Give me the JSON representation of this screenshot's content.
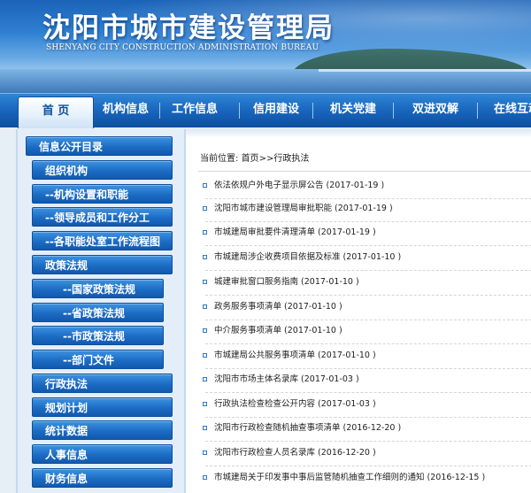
{
  "header": {
    "title": "沈阳市城市建设管理局",
    "subtitle": "SHENYANG CITY CONSTRUCTION ADMINISTRATION BUREAU"
  },
  "nav": {
    "items": [
      {
        "label": "首  页",
        "active": true
      },
      {
        "label": "机构信息"
      },
      {
        "label": "工作信息"
      },
      {
        "label": "信用建设"
      },
      {
        "label": "机关党建"
      },
      {
        "label": "双进双解"
      },
      {
        "label": "在线互动"
      }
    ]
  },
  "sidebar": {
    "items": [
      {
        "label": "信息公开目录"
      },
      {
        "label": "组织机构"
      },
      {
        "label": "--机构设置和职能"
      },
      {
        "label": "--领导成员和工作分工"
      },
      {
        "label": "--各职能处室工作流程图"
      },
      {
        "label": "政策法规"
      },
      {
        "label": "--国家政策法规"
      },
      {
        "label": "--省政策法规"
      },
      {
        "label": "--市政策法规"
      },
      {
        "label": "--部门文件"
      },
      {
        "label": "行政执法"
      },
      {
        "label": "规划计划"
      },
      {
        "label": "统计数据"
      },
      {
        "label": "人事信息"
      },
      {
        "label": "财务信息"
      }
    ]
  },
  "breadcrumb": {
    "prefix": "当前位置:",
    "home": "首页",
    "separator": ">>",
    "current": "行政执法"
  },
  "articles": [
    {
      "title": "依法依规户外电子显示屏公告",
      "date": "(2017-01-19 )"
    },
    {
      "title": "沈阳市城市建设管理局审批职能",
      "date": "(2017-01-19 )"
    },
    {
      "title": "市城建局审批要件清理清单",
      "date": "(2017-01-19 )"
    },
    {
      "title": "市城建局涉企收费项目依据及标准",
      "date": "(2017-01-10 )"
    },
    {
      "title": "城建审批窗口服务指南",
      "date": "(2017-01-10 )"
    },
    {
      "title": "政务服务事项清单",
      "date": "(2017-01-10 )"
    },
    {
      "title": "中介服务事项清单",
      "date": "(2017-01-10 )"
    },
    {
      "title": "市城建局公共服务事项清单",
      "date": "(2017-01-10 )"
    },
    {
      "title": "沈阳市市场主体名录库",
      "date": "(2017-01-03 )"
    },
    {
      "title": "行政执法检查检查公开内容",
      "date": "(2017-01-03 )"
    },
    {
      "title": "沈阳市行政检查随机抽查事项清单",
      "date": "(2016-12-20 )"
    },
    {
      "title": "沈阳市行政检查人员名录库",
      "date": "(2016-12-20 )"
    },
    {
      "title": "市城建局关于印发事中事后监管随机抽查工作细则的通知",
      "date": "(2016-12-15 )"
    }
  ]
}
